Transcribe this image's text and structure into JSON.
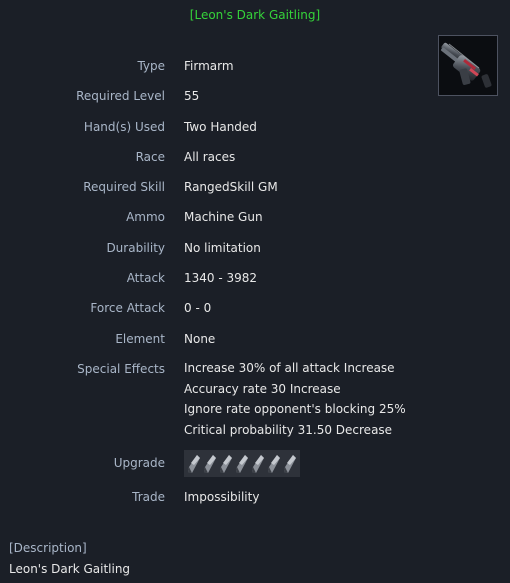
{
  "item": {
    "title": "[Leon's Dark Gaitling]",
    "icon": "gatling-gun-icon"
  },
  "stats": [
    {
      "label": "Type",
      "value": "Firmarm"
    },
    {
      "label": "Required Level",
      "value": "55"
    },
    {
      "label": "Hand(s) Used",
      "value": "Two Handed"
    },
    {
      "label": "Race",
      "value": "All races"
    },
    {
      "label": "Required Skill",
      "value": "RangedSkill GM"
    },
    {
      "label": "Ammo",
      "value": "Machine Gun"
    },
    {
      "label": "Durability",
      "value": "No limitation"
    },
    {
      "label": "Attack",
      "value": "1340 - 3982"
    },
    {
      "label": "Force Attack",
      "value": "0 - 0"
    },
    {
      "label": "Element",
      "value": "None"
    }
  ],
  "special_effects": {
    "label": "Special Effects",
    "lines": [
      "Increase 30% of all attack Increase",
      "Accuracy rate 30 Increase",
      "Ignore rate opponent's blocking 25%",
      "Critical probability 31.50 Decrease"
    ]
  },
  "upgrade": {
    "label": "Upgrade",
    "slot_icon": "talic-crystal-icon",
    "slot_count": 7
  },
  "trade": {
    "label": "Trade",
    "value": "Impossibility"
  },
  "description": {
    "header": "[Description]",
    "text": "Leon's Dark Gaitling"
  },
  "colors": {
    "background": "#1b1f27",
    "title": "#35d33a",
    "label": "#a9b6c8",
    "value": "#e8e8e8"
  }
}
